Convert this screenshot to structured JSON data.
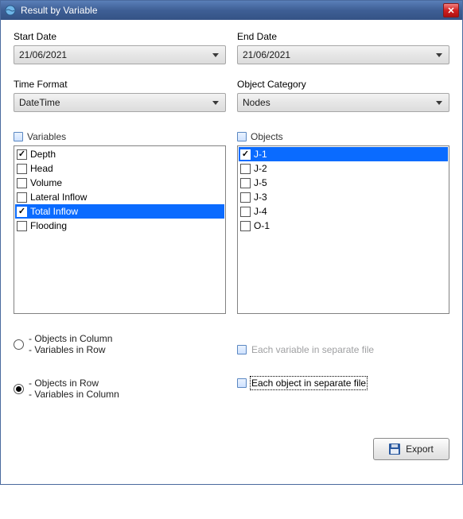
{
  "window": {
    "title": "Result by Variable"
  },
  "fields": {
    "start_date_label": "Start Date",
    "start_date_value": "21/06/2021",
    "end_date_label": "End Date",
    "end_date_value": "21/06/2021",
    "time_format_label": "Time Format",
    "time_format_value": "DateTime",
    "object_category_label": "Object Category",
    "object_category_value": "Nodes"
  },
  "variables": {
    "header": "Variables",
    "items": [
      {
        "label": "Depth",
        "checked": true,
        "selected": false
      },
      {
        "label": "Head",
        "checked": false,
        "selected": false
      },
      {
        "label": "Volume",
        "checked": false,
        "selected": false
      },
      {
        "label": "Lateral Inflow",
        "checked": false,
        "selected": false
      },
      {
        "label": "Total Inflow",
        "checked": true,
        "selected": true
      },
      {
        "label": "Flooding",
        "checked": false,
        "selected": false
      }
    ]
  },
  "objects": {
    "header": "Objects",
    "items": [
      {
        "label": "J-1",
        "checked": true,
        "selected": true
      },
      {
        "label": "J-2",
        "checked": false,
        "selected": false
      },
      {
        "label": "J-5",
        "checked": false,
        "selected": false
      },
      {
        "label": "J-3",
        "checked": false,
        "selected": false
      },
      {
        "label": "J-4",
        "checked": false,
        "selected": false
      },
      {
        "label": "O-1",
        "checked": false,
        "selected": false
      }
    ]
  },
  "layout": {
    "radio": [
      {
        "line1": "- Objects in Column",
        "line2": "- Variables in Row",
        "checked": false
      },
      {
        "line1": "- Objects in Row",
        "line2": "- Variables in Column",
        "checked": true
      }
    ],
    "opt_each_variable": {
      "label": "Each variable in separate file",
      "enabled": false
    },
    "opt_each_object": {
      "label": "Each object in separate file",
      "enabled": true,
      "focused": true
    }
  },
  "buttons": {
    "export": "Export"
  }
}
